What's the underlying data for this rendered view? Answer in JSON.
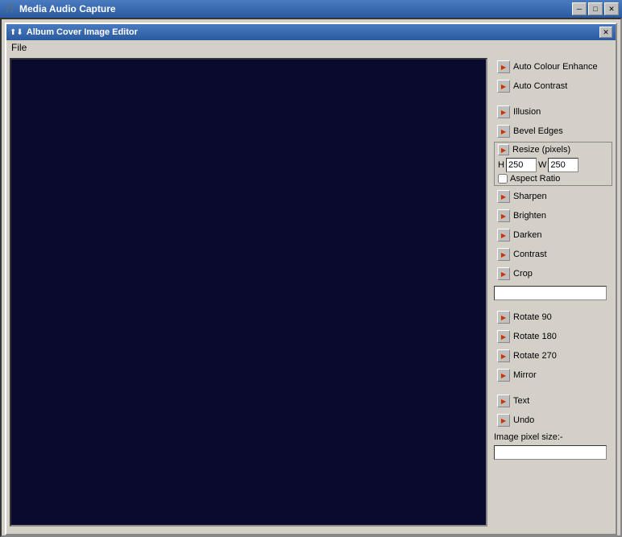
{
  "window": {
    "title": "Media Audio Capture",
    "inner_title": "Album Cover Image Editor",
    "close_label": "✕",
    "minimize_label": "─",
    "maximize_label": "□"
  },
  "menu": {
    "file_label": "File"
  },
  "sidebar": {
    "buttons": [
      {
        "id": "auto-colour-enhance",
        "label": "Auto Colour Enhance"
      },
      {
        "id": "auto-contrast",
        "label": "Auto Contrast"
      },
      {
        "id": "illusion",
        "label": "Illusion"
      },
      {
        "id": "bevel-edges",
        "label": "Bevel Edges"
      }
    ],
    "resize": {
      "title": "Resize (pixels)",
      "h_label": "H",
      "w_label": "W",
      "h_value": "250",
      "w_value": "250",
      "aspect_label": "Aspect Ratio"
    },
    "buttons2": [
      {
        "id": "sharpen",
        "label": "Sharpen"
      },
      {
        "id": "brighten",
        "label": "Brighten"
      },
      {
        "id": "darken",
        "label": "Darken"
      },
      {
        "id": "contrast",
        "label": "Contrast"
      },
      {
        "id": "crop",
        "label": "Crop"
      }
    ],
    "crop_value": "",
    "buttons3": [
      {
        "id": "rotate-90",
        "label": "Rotate 90"
      },
      {
        "id": "rotate-180",
        "label": "Rotate 180"
      },
      {
        "id": "rotate-270",
        "label": "Rotate 270"
      },
      {
        "id": "mirror",
        "label": "Mirror"
      }
    ],
    "buttons4": [
      {
        "id": "text",
        "label": "Text"
      },
      {
        "id": "undo",
        "label": "Undo"
      }
    ],
    "pixel_size_label": "Image pixel size:-",
    "pixel_size_value": ""
  },
  "icons": {
    "arrow": "▶",
    "window_icon": "🎵"
  }
}
